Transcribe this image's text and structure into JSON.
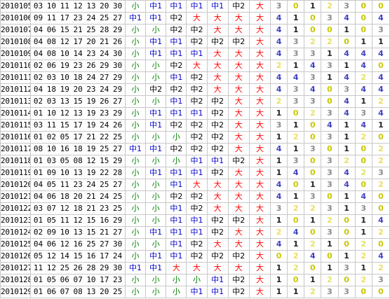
{
  "colors": {
    "small": "#008000",
    "mid1": "#0000cc",
    "mid2": "#000000",
    "big": "#ff0000",
    "grid": "#c8c8c8"
  },
  "rows": [
    {
      "period": "2010105",
      "numbers": "03 10 11 12 13 20 30",
      "labels": [
        "小",
        "中1",
        "中1",
        "中1",
        "中1",
        "中2",
        "大"
      ],
      "counts": [
        "3",
        "0",
        "1",
        "2",
        "3",
        "0",
        "0"
      ]
    },
    {
      "period": "2010106",
      "numbers": "09 11 17 23 24 25 27",
      "labels": [
        "中1",
        "中1",
        "中2",
        "大",
        "大",
        "大",
        "大"
      ],
      "counts": [
        "4",
        "1",
        "0",
        "3",
        "4",
        "0",
        "4"
      ]
    },
    {
      "period": "2010107",
      "numbers": "04 06 15 21 25 28 29",
      "labels": [
        "小",
        "小",
        "中2",
        "中2",
        "大",
        "大",
        "大"
      ],
      "counts": [
        "4",
        "1",
        "0",
        "0",
        "1",
        "0",
        "3"
      ]
    },
    {
      "period": "2010108",
      "numbers": "04 08 12 17 20 21 26",
      "labels": [
        "小",
        "中1",
        "中1",
        "中2",
        "中2",
        "中2",
        "大"
      ],
      "counts": [
        "4",
        "3",
        "2",
        "2",
        "0",
        "1",
        "1"
      ]
    },
    {
      "period": "2010109",
      "numbers": "04 08 10 14 23 24 30",
      "labels": [
        "小",
        "中1",
        "中1",
        "中1",
        "大",
        "大",
        "大"
      ],
      "counts": [
        "4",
        "3",
        "3",
        "1",
        "4",
        "4",
        "4"
      ]
    },
    {
      "period": "2010110",
      "numbers": "02 06 19 23 26 29 30",
      "labels": [
        "小",
        "小",
        "中2",
        "大",
        "大",
        "大",
        "大"
      ],
      "counts": [
        "2",
        "1",
        "4",
        "3",
        "1",
        "4",
        "0"
      ]
    },
    {
      "period": "2010111",
      "numbers": "02 03 10 18 24 27 29",
      "labels": [
        "小",
        "小",
        "中1",
        "中2",
        "大",
        "大",
        "大"
      ],
      "counts": [
        "4",
        "4",
        "3",
        "1",
        "4",
        "2",
        "4"
      ]
    },
    {
      "period": "2010112",
      "numbers": "04 18 19 20 23 24 29",
      "labels": [
        "小",
        "中2",
        "中2",
        "中2",
        "大",
        "大",
        "大"
      ],
      "counts": [
        "4",
        "3",
        "4",
        "0",
        "3",
        "4",
        "4"
      ]
    },
    {
      "period": "2010113",
      "numbers": "02 03 13 15 19 26 27",
      "labels": [
        "小",
        "小",
        "中1",
        "中2",
        "中2",
        "大",
        "大"
      ],
      "counts": [
        "2",
        "3",
        "3",
        "0",
        "4",
        "1",
        "2"
      ]
    },
    {
      "period": "2010114",
      "numbers": "01 10 12 13 19 23 29",
      "labels": [
        "小",
        "中1",
        "中1",
        "中1",
        "中2",
        "大",
        "大"
      ],
      "counts": [
        "1",
        "0",
        "2",
        "3",
        "4",
        "3",
        "4"
      ]
    },
    {
      "period": "2010115",
      "numbers": "03 11 15 17 19 24 26",
      "labels": [
        "小",
        "中1",
        "中2",
        "中2",
        "中2",
        "大",
        "大"
      ],
      "counts": [
        "3",
        "1",
        "0",
        "4",
        "1",
        "4",
        "1"
      ]
    },
    {
      "period": "2010116",
      "numbers": "01 02 05 17 21 22 25",
      "labels": [
        "小",
        "小",
        "小",
        "中2",
        "中2",
        "大",
        "大"
      ],
      "counts": [
        "1",
        "2",
        "0",
        "3",
        "1",
        "2",
        "0"
      ]
    },
    {
      "period": "2010117",
      "numbers": "08 10 16 18 19 25 27",
      "labels": [
        "中1",
        "中1",
        "中2",
        "中2",
        "中2",
        "大",
        "大"
      ],
      "counts": [
        "4",
        "1",
        "3",
        "0",
        "1",
        "0",
        "2"
      ]
    },
    {
      "period": "2010118",
      "numbers": "01 03 05 08 12 15 29",
      "labels": [
        "小",
        "小",
        "小",
        "中1",
        "中1",
        "中2",
        "大"
      ],
      "counts": [
        "1",
        "3",
        "0",
        "3",
        "2",
        "0",
        "2"
      ]
    },
    {
      "period": "2010119",
      "numbers": "01 09 10 13 19 22 28",
      "labels": [
        "小",
        "中1",
        "中1",
        "中1",
        "中2",
        "大",
        "大"
      ],
      "counts": [
        "1",
        "4",
        "0",
        "3",
        "4",
        "2",
        "3"
      ]
    },
    {
      "period": "2010120",
      "numbers": "04 05 11 23 24 25 27",
      "labels": [
        "小",
        "小",
        "中1",
        "大",
        "大",
        "大",
        "大"
      ],
      "counts": [
        "4",
        "0",
        "1",
        "3",
        "4",
        "0",
        "2"
      ]
    },
    {
      "period": "2010121",
      "numbers": "04 06 18 20 21 24 25",
      "labels": [
        "小",
        "小",
        "中2",
        "中2",
        "大",
        "大",
        "大"
      ],
      "counts": [
        "4",
        "1",
        "3",
        "0",
        "1",
        "4",
        "0"
      ]
    },
    {
      "period": "2010122",
      "numbers": "03 07 12 18 21 23 25",
      "labels": [
        "小",
        "小",
        "中1",
        "中2",
        "大",
        "大",
        "大"
      ],
      "counts": [
        "3",
        "2",
        "2",
        "3",
        "1",
        "3",
        "0"
      ]
    },
    {
      "period": "2010123",
      "numbers": "01 05 11 12 15 16 29",
      "labels": [
        "小",
        "小",
        "中1",
        "中1",
        "中2",
        "中2",
        "大"
      ],
      "counts": [
        "1",
        "0",
        "1",
        "2",
        "0",
        "1",
        "4"
      ]
    },
    {
      "period": "2010124",
      "numbers": "02 09 10 13 15 21 27",
      "labels": [
        "小",
        "中1",
        "中1",
        "中1",
        "中2",
        "大",
        "大"
      ],
      "counts": [
        "2",
        "4",
        "0",
        "3",
        "0",
        "1",
        "2"
      ]
    },
    {
      "period": "2010125",
      "numbers": "04 06 12 16 25 27 30",
      "labels": [
        "小",
        "小",
        "中1",
        "中2",
        "大",
        "大",
        "大"
      ],
      "counts": [
        "4",
        "1",
        "2",
        "1",
        "0",
        "2",
        "0"
      ]
    },
    {
      "period": "2010126",
      "numbers": "05 12 14 15 16 17 24",
      "labels": [
        "小",
        "中1",
        "中1",
        "中2",
        "中2",
        "中2",
        "大"
      ],
      "counts": [
        "0",
        "2",
        "4",
        "0",
        "1",
        "2",
        "4"
      ]
    },
    {
      "period": "2010127",
      "numbers": "11 12 25 26 28 29 30",
      "labels": [
        "中1",
        "中1",
        "大",
        "大",
        "大",
        "大",
        "大"
      ],
      "counts": [
        "1",
        "2",
        "0",
        "1",
        "3",
        "1",
        "2"
      ]
    },
    {
      "period": "2010128",
      "numbers": "01 05 06 07 10 17 23",
      "labels": [
        "小",
        "小",
        "小",
        "小",
        "中1",
        "中2",
        "大"
      ],
      "counts": [
        "1",
        "0",
        "1",
        "2",
        "0",
        "2",
        "3"
      ]
    },
    {
      "period": "2010129",
      "numbers": "01 06 07 08 13 20 25",
      "labels": [
        "小",
        "小",
        "小",
        "中1",
        "中1",
        "中2",
        "大"
      ],
      "counts": [
        "1",
        "1",
        "2",
        "3",
        "3",
        "0",
        "0"
      ]
    }
  ]
}
